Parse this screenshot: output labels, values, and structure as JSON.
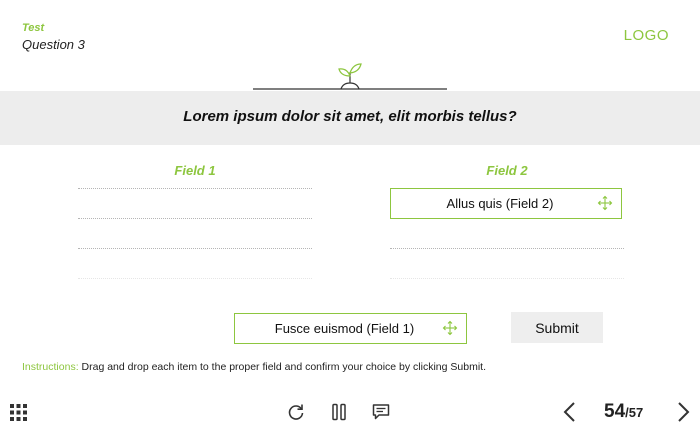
{
  "header": {
    "test_label": "Test",
    "question_label": "Question 3",
    "logo": "LOGO"
  },
  "question": {
    "text": "Lorem ipsum dolor sit amet, elit morbis tellus?"
  },
  "fields": [
    {
      "title": "Field 1",
      "slots": [
        "",
        "",
        ""
      ]
    },
    {
      "title": "Field 2",
      "slots": [
        "Allus quis (Field 2)",
        "",
        ""
      ]
    }
  ],
  "drag_items": [
    {
      "label": "Allus quis (Field 2)",
      "placed_in": "Field 2",
      "icon": "move-icon"
    },
    {
      "label": "Fusce euismod (Field 1)",
      "placed_in": "",
      "icon": "move-icon"
    }
  ],
  "submit_label": "Submit",
  "instructions": {
    "lead": "Instructions:",
    "text": " Drag and drop each item to the proper field and confirm your choice by clicking Submit."
  },
  "toolbar": {
    "menu_icon": "grid-menu-icon",
    "replay_icon": "replay-icon",
    "pause_icon": "pause-icon",
    "comment_icon": "comment-icon",
    "prev_icon": "chevron-left-icon",
    "next_icon": "chevron-right-icon",
    "current_page": "54",
    "total_pages": "/57"
  },
  "colors": {
    "accent": "#8dc63f",
    "band": "#ededed",
    "text": "#222222"
  }
}
